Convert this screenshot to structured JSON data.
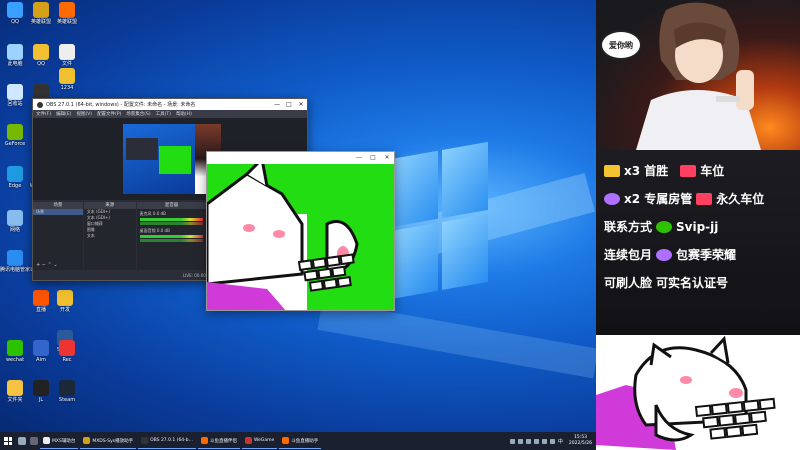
{
  "desktop": {
    "icons": [
      {
        "label": "QQ",
        "color": "#3aa0ff"
      },
      {
        "label": "英雄联盟",
        "color": "#d4a017"
      },
      {
        "label": "英雄联盟",
        "color": "#ff6a00"
      },
      {
        "label": "此电脑",
        "color": "#9cd4ff"
      },
      {
        "label": "QQ",
        "color": "#f0c030"
      },
      {
        "label": "文件",
        "color": "#eeeeee"
      },
      {
        "label": "1234",
        "color": "#f0c030"
      },
      {
        "label": "回收站",
        "color": "#cfe8ff"
      },
      {
        "label": "OBS",
        "color": "#333333"
      },
      {
        "label": "GeForce",
        "color": "#76b900"
      },
      {
        "label": "Edge",
        "color": "#1e9be0"
      },
      {
        "label": "WeGame",
        "color": "#cccccc"
      },
      {
        "label": "网络",
        "color": "#88bbee"
      },
      {
        "label": "腾讯电脑管家",
        "color": "#2a8ef0"
      },
      {
        "label": "Logitech",
        "color": "#999999"
      },
      {
        "label": "直播",
        "color": "#ff5500"
      },
      {
        "label": "开发",
        "color": "#f0c030"
      },
      {
        "label": "Steam",
        "color": "#2a5a9a"
      },
      {
        "label": "wechat",
        "color": "#2dc100"
      },
      {
        "label": "Aim",
        "color": "#3366cc"
      },
      {
        "label": "Rec",
        "color": "#ee3333"
      },
      {
        "label": "文件夹",
        "color": "#f5c242"
      },
      {
        "label": "JL",
        "color": "#222222"
      },
      {
        "label": "Steam",
        "color": "#1b2838"
      }
    ]
  },
  "obs": {
    "title": "OBS 27.0.1 (64-bit, windows) - 配置文件: 未命名 - 场景: 未命名",
    "minimize": "—",
    "maximize": "□",
    "close": "✕",
    "menu": [
      "文件(F)",
      "编辑(E)",
      "视图(V)",
      "配置文件(P)",
      "场景集合(S)",
      "工具(T)",
      "帮助(H)"
    ],
    "docks": {
      "scenes_title": "场景",
      "scenes": [
        "场景"
      ],
      "sources_title": "来源",
      "sources": [
        "文本 (GDI+)",
        "文本 (GDI+)",
        "窗口捕获",
        "图像",
        "文本"
      ],
      "mixer_title": "混音器",
      "mixer": [
        {
          "label": "麦克风",
          "value": "0.0 dB"
        },
        {
          "label": "桌面音频",
          "value": "0.0 dB"
        }
      ],
      "transitions_title": "场景过渡",
      "transition_type": "淡出",
      "duration_label": "时长",
      "duration_value": "300 ms",
      "controls_title": "控件",
      "controls": [
        "停止推流",
        "开始录制",
        "工作室模式",
        "设置",
        "退出"
      ]
    },
    "status": [
      "LIVE: 00:00:00",
      "REC: 00:00:00",
      "CPU: 1.3%, 60.00 fps"
    ]
  },
  "catwin": {
    "minimize": "—",
    "maximize": "□",
    "close": "✕"
  },
  "taskbar": {
    "tasks": [
      {
        "label": "MXS辅助台",
        "color": "#eeeeee"
      },
      {
        "label": "MXDS-Sys播放助手",
        "color": "#d4a017"
      },
      {
        "label": "OBS 27.0.1 (64-b...",
        "color": "#333333"
      },
      {
        "label": "斗鱼直播伴侣",
        "color": "#ff6a00"
      },
      {
        "label": "WeGame",
        "color": "#cc3333"
      },
      {
        "label": "斗鱼直播助手",
        "color": "#ff6a00"
      }
    ],
    "time": "15:53",
    "date": "2022/5/26",
    "lang": "中"
  },
  "panel": {
    "bubble_text": "爱你哟",
    "lines": [
      {
        "text": "x3 首胜",
        "extra": "车位",
        "c1": "#f2c530",
        "c2": "#ff4060"
      },
      {
        "text": "x2 专属房管",
        "extra": "永久车位",
        "c1": "#b070ff",
        "c2": "#ff4060"
      },
      {
        "text": "联系方式",
        "extra": "Svip-jj",
        "c1": "",
        "c2": "#2dc100"
      },
      {
        "text": "连续包月",
        "extra": "包赛季荣耀",
        "c1": "",
        "c2": "#b070ff"
      },
      {
        "text": "可刷人脸",
        "extra": "可实名认证号",
        "c1": "",
        "c2": ""
      }
    ]
  },
  "colors": {
    "green_screen": "#22dd11",
    "purple_pad": "#d03ad8"
  }
}
